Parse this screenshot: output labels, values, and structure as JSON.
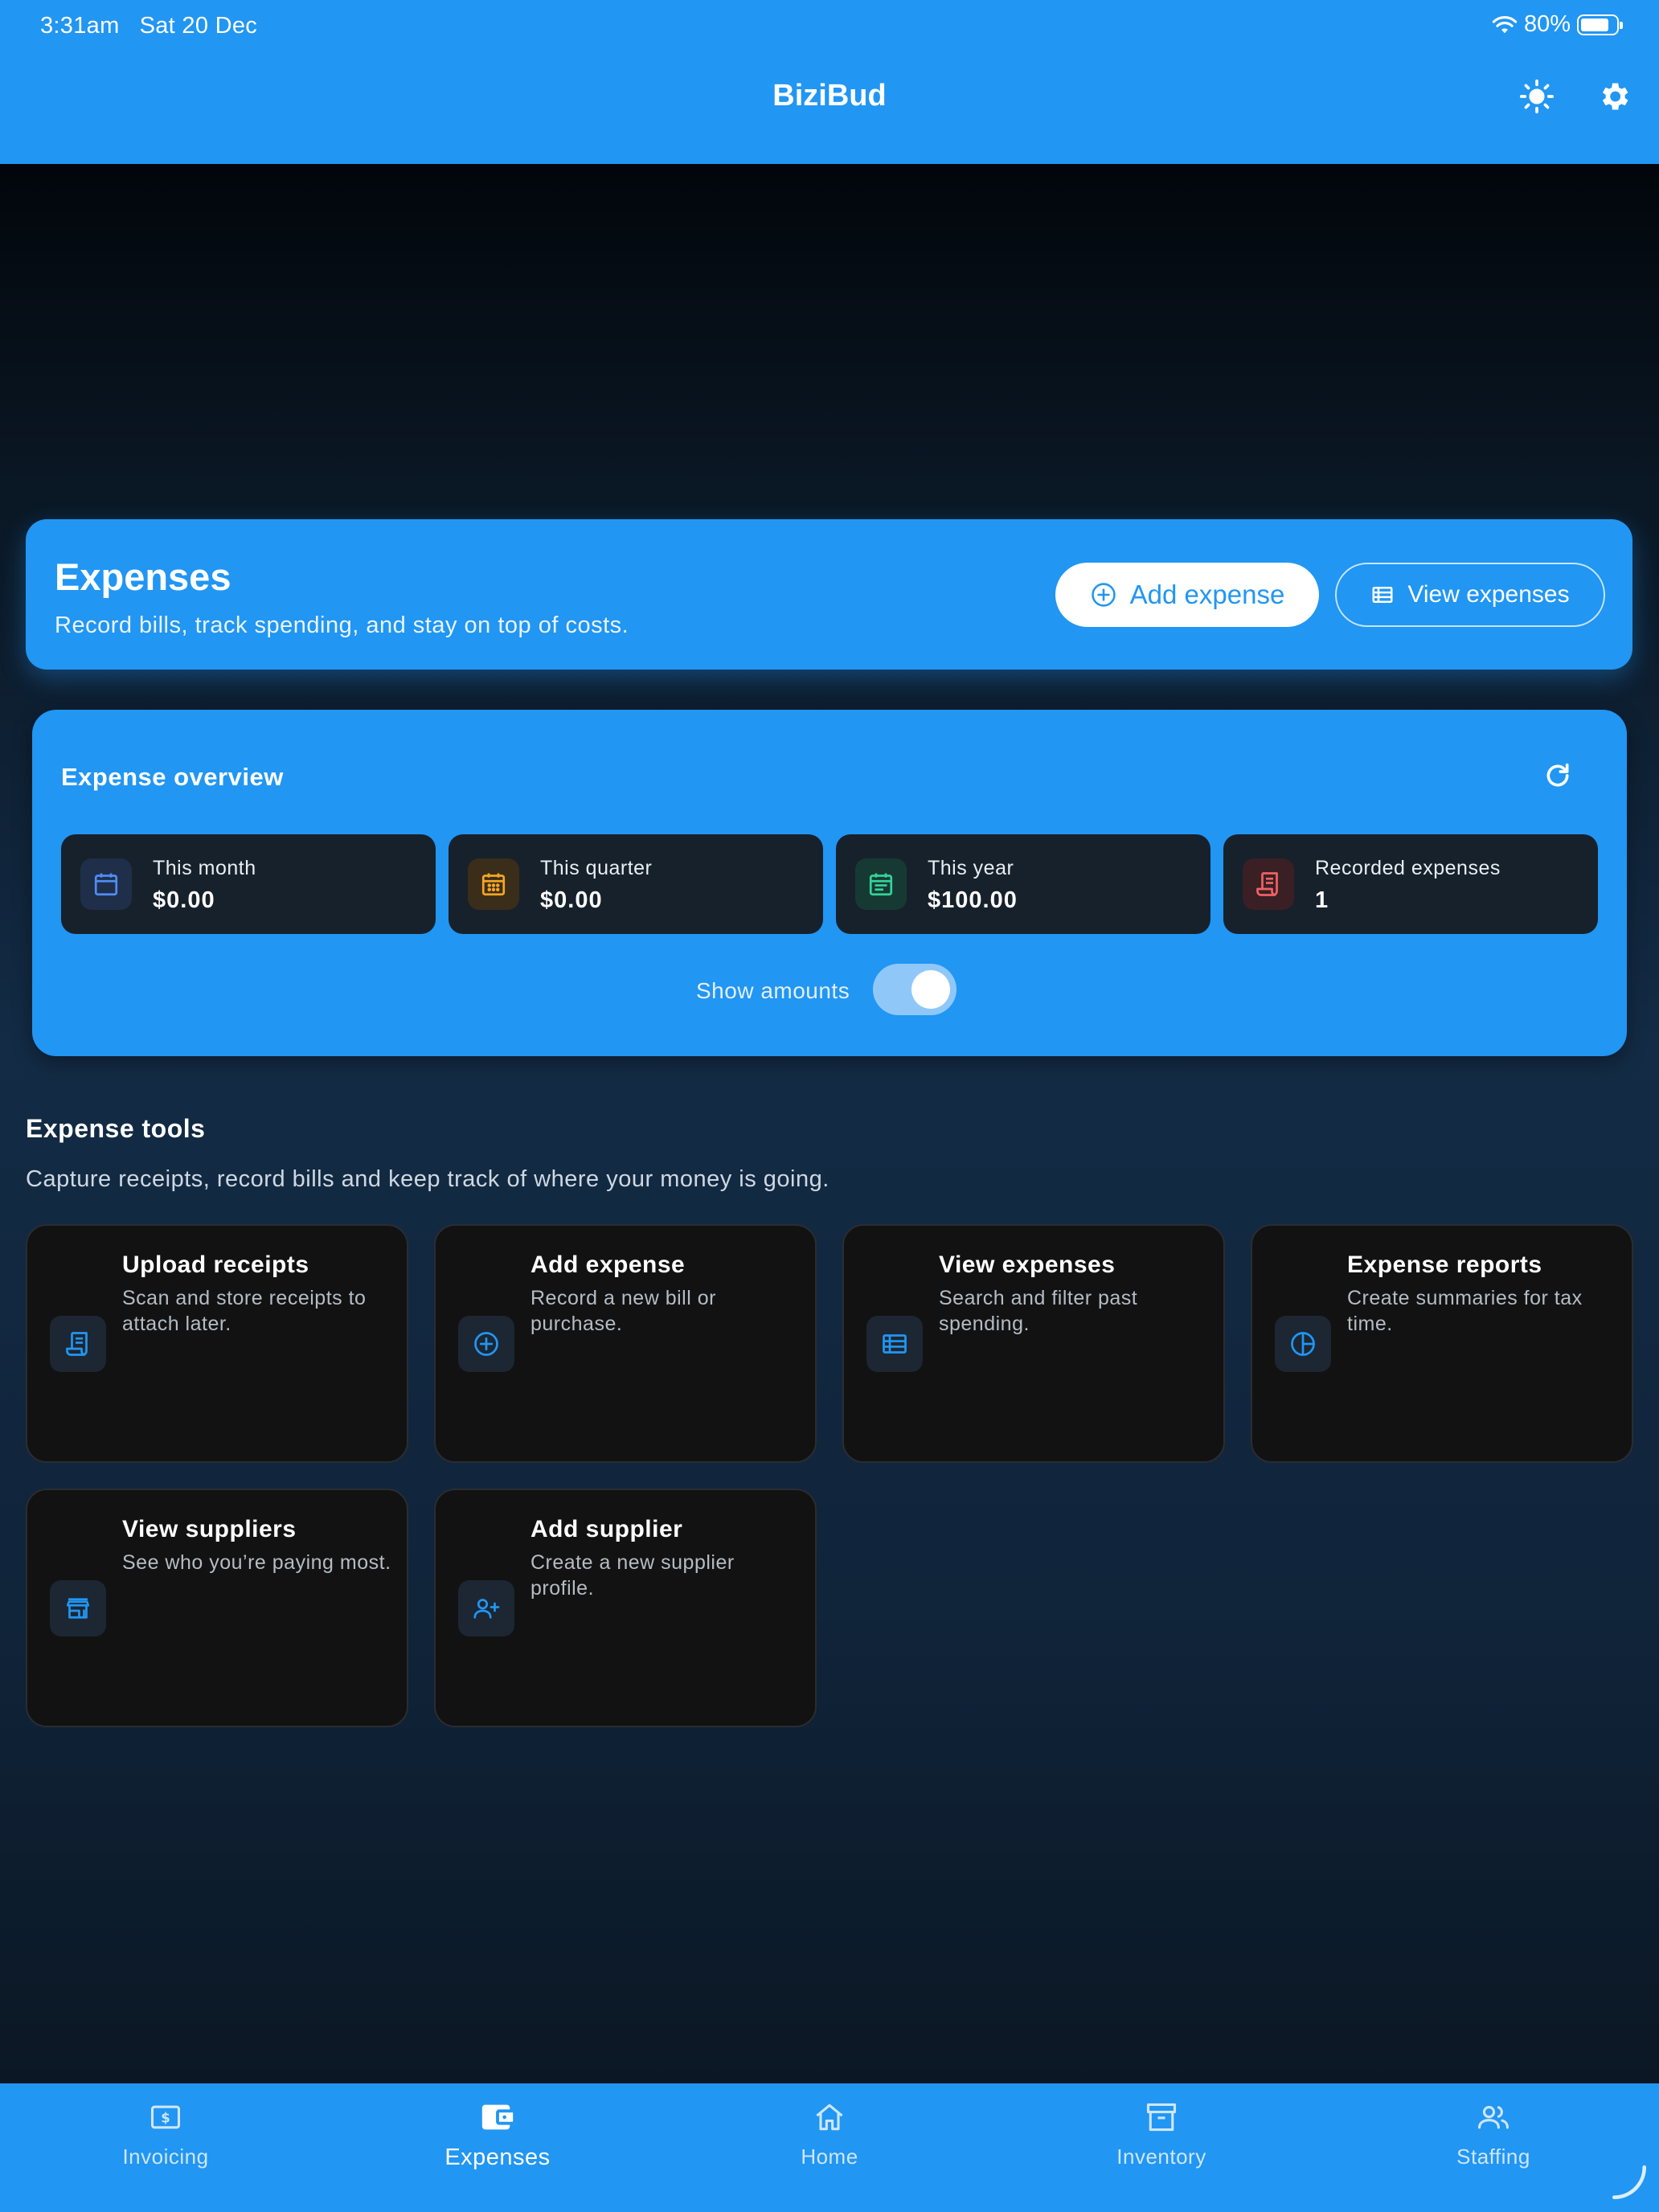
{
  "status_bar": {
    "time": "3:31am",
    "date": "Sat 20 Dec",
    "battery": "80%"
  },
  "header": {
    "title": "BiziBud",
    "icons": [
      "brightness-icon",
      "settings-icon"
    ]
  },
  "hero": {
    "title": "Expenses",
    "subtitle": "Record bills, track spending, and stay on top of costs.",
    "add_label": "Add expense",
    "view_label": "View expenses"
  },
  "overview": {
    "title": "Expense overview",
    "stats": [
      {
        "label": "This month",
        "value": "$0.00",
        "icon": "calendar-icon",
        "color": "#4f8df5"
      },
      {
        "label": "This quarter",
        "value": "$0.00",
        "icon": "calendar-grid-icon",
        "color": "#f5a623"
      },
      {
        "label": "This year",
        "value": "$100.00",
        "icon": "calendar-notes-icon",
        "color": "#34d399"
      },
      {
        "label": "Recorded expenses",
        "value": "1",
        "icon": "receipt-icon",
        "color": "#f06262"
      }
    ],
    "toggle_label": "Show amounts",
    "toggle_on": true
  },
  "tools": {
    "title": "Expense tools",
    "subtitle": "Capture receipts, record bills and keep track of where your money is going.",
    "items": [
      {
        "title": "Upload receipts",
        "desc": "Scan and store receipts to attach later.",
        "icon": "receipt-icon"
      },
      {
        "title": "Add expense",
        "desc": "Record a new bill or purchase.",
        "icon": "add-circle-icon"
      },
      {
        "title": "View expenses",
        "desc": "Search and filter past spending.",
        "icon": "list-icon"
      },
      {
        "title": "Expense reports",
        "desc": "Create summaries for tax time.",
        "icon": "pie-chart-icon"
      },
      {
        "title": "View suppliers",
        "desc": "See who you’re paying most.",
        "icon": "store-icon"
      },
      {
        "title": "Add supplier",
        "desc": "Create a new supplier profile.",
        "icon": "person-add-icon"
      }
    ]
  },
  "bottom_nav": {
    "items": [
      {
        "label": "Invoicing",
        "icon": "invoice-icon"
      },
      {
        "label": "Expenses",
        "icon": "wallet-icon",
        "active": true
      },
      {
        "label": "Home",
        "icon": "home-icon"
      },
      {
        "label": "Inventory",
        "icon": "archive-icon"
      },
      {
        "label": "Staffing",
        "icon": "people-icon"
      }
    ]
  },
  "colors": {
    "accent": "#2196f3",
    "card": "#17212c",
    "tile": "#121212"
  }
}
